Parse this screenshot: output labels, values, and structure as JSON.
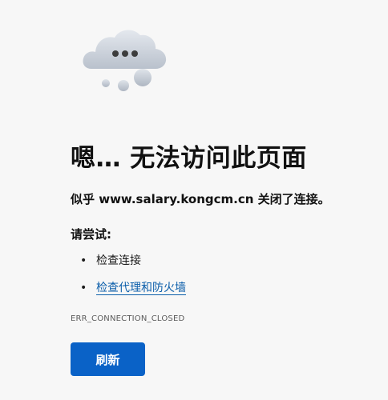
{
  "error": {
    "icon": "cloud-ellipsis-icon",
    "title": "嗯… 无法访问此页面",
    "message": "似乎 www.salary.kongcm.cn 关闭了连接。",
    "try_label": "请尝试:",
    "suggestions": [
      {
        "label": "检查连接",
        "is_link": false
      },
      {
        "label": "检查代理和防火墙",
        "is_link": true
      }
    ],
    "code": "ERR_CONNECTION_CLOSED",
    "refresh_label": "刷新"
  },
  "colors": {
    "background": "#f7f7f7",
    "button": "#0a62c7",
    "link": "#0b5eaa"
  }
}
